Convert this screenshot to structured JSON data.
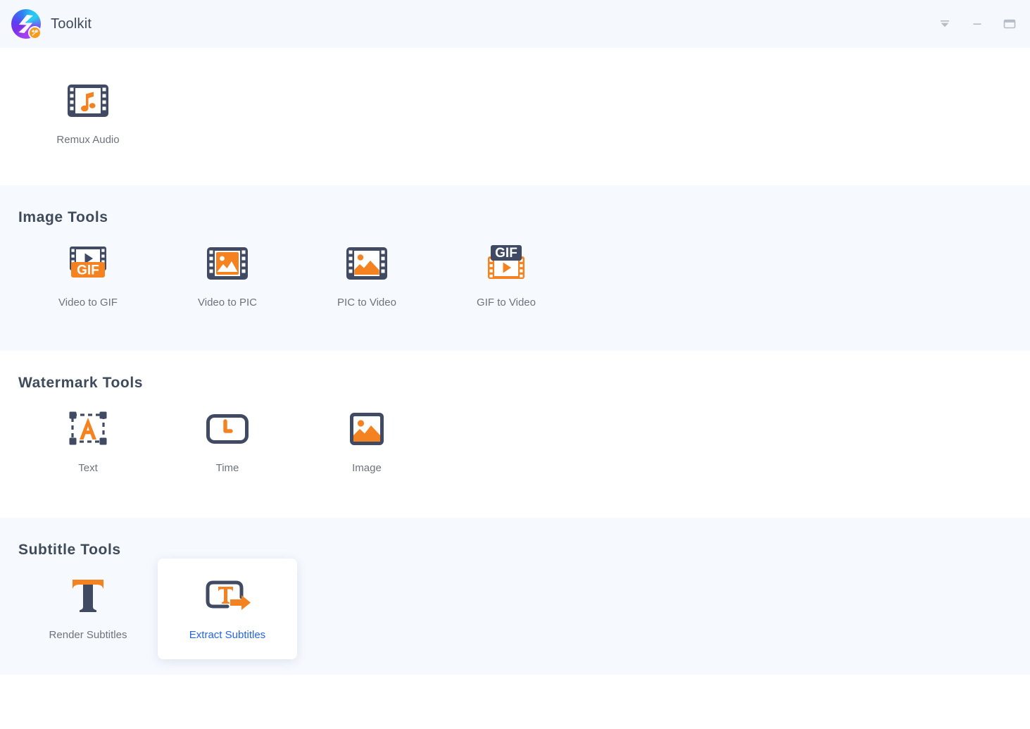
{
  "window": {
    "title": "Toolkit",
    "controls": [
      {
        "name": "collapse-button",
        "icon": "collapse-icon"
      },
      {
        "name": "minimize-button",
        "icon": "minimize-icon"
      },
      {
        "name": "maximize-button",
        "icon": "maximize-icon"
      }
    ]
  },
  "sections": [
    {
      "id": "top-tools",
      "title": "",
      "background": "#ffffff",
      "tools": [
        {
          "label": "Remux Audio",
          "icon": "film-music-note-icon",
          "active": false
        }
      ]
    },
    {
      "id": "image-tools",
      "title": "Image Tools",
      "background": "#f6f9fe",
      "tools": [
        {
          "label": "Video to GIF",
          "icon": "film-play-gif-icon",
          "active": false
        },
        {
          "label": "Video to PIC",
          "icon": "film-picture-icon",
          "active": false
        },
        {
          "label": "PIC to Video",
          "icon": "film-landscape-icon",
          "active": false
        },
        {
          "label": "GIF to Video",
          "icon": "gif-film-play-icon",
          "active": false
        }
      ]
    },
    {
      "id": "watermark-tools",
      "title": "Watermark Tools",
      "background": "#ffffff",
      "tools": [
        {
          "label": "Text",
          "icon": "text-watermark-icon",
          "active": false
        },
        {
          "label": "Time",
          "icon": "clock-watermark-icon",
          "active": false
        },
        {
          "label": "Image",
          "icon": "image-watermark-icon",
          "active": false
        }
      ]
    },
    {
      "id": "subtitle-tools",
      "title": "Subtitle Tools",
      "background": "#f6f9fe",
      "tools": [
        {
          "label": "Render Subtitles",
          "icon": "subtitle-t-icon",
          "active": false
        },
        {
          "label": "Extract Subtitles",
          "icon": "extract-subtitle-icon",
          "active": true
        }
      ]
    }
  ],
  "colors": {
    "accent_orange": "#f58220",
    "dark_navy": "#404a63",
    "label_gray": "#6e737b",
    "heading": "#3f4a5a",
    "active_label_blue": "#2563eb",
    "shaded_bg": "#f6f9fe",
    "titlebar_bg": "#f5f8fc"
  }
}
